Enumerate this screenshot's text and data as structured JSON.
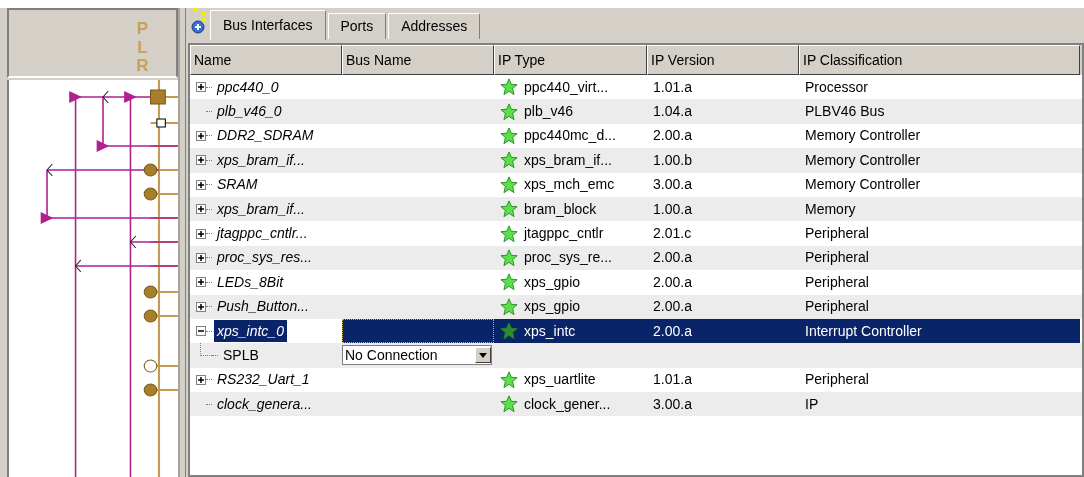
{
  "bus_panel": {
    "label": "PLR"
  },
  "tabs": [
    {
      "label": "Bus Interfaces",
      "selected": true
    },
    {
      "label": "Ports",
      "selected": false
    },
    {
      "label": "Addresses",
      "selected": false
    }
  ],
  "table": {
    "columns": [
      "Name",
      "Bus Name",
      "IP Type",
      "IP Version",
      "IP Classification"
    ],
    "rows": [
      {
        "kind": "instance",
        "has_children": true,
        "expanded": false,
        "name": "ppc440_0",
        "ip_type": "ppc440_virt...",
        "ip_version": "1.01.a",
        "ip_classification": "Processor",
        "selected": false
      },
      {
        "kind": "instance",
        "has_children": false,
        "name": "plb_v46_0",
        "ip_type": "plb_v46",
        "ip_version": "1.04.a",
        "ip_classification": "PLBV46 Bus",
        "selected": false
      },
      {
        "kind": "instance",
        "has_children": true,
        "expanded": false,
        "name": "DDR2_SDRAM",
        "ip_type": "ppc440mc_d...",
        "ip_version": "2.00.a",
        "ip_classification": "Memory Controller",
        "selected": false
      },
      {
        "kind": "instance",
        "has_children": true,
        "expanded": false,
        "name": "xps_bram_if...",
        "ip_type": "xps_bram_if...",
        "ip_version": "1.00.b",
        "ip_classification": "Memory Controller",
        "selected": false
      },
      {
        "kind": "instance",
        "has_children": true,
        "expanded": false,
        "name": "SRAM",
        "ip_type": "xps_mch_emc",
        "ip_version": "3.00.a",
        "ip_classification": "Memory Controller",
        "selected": false
      },
      {
        "kind": "instance",
        "has_children": true,
        "expanded": false,
        "name": "xps_bram_if...",
        "ip_type": "bram_block",
        "ip_version": "1.00.a",
        "ip_classification": "Memory",
        "selected": false
      },
      {
        "kind": "instance",
        "has_children": true,
        "expanded": false,
        "name": "jtagppc_cntlr...",
        "ip_type": "jtagppc_cntlr",
        "ip_version": "2.01.c",
        "ip_classification": "Peripheral",
        "selected": false
      },
      {
        "kind": "instance",
        "has_children": true,
        "expanded": false,
        "name": "proc_sys_res...",
        "ip_type": "proc_sys_re...",
        "ip_version": "2.00.a",
        "ip_classification": "Peripheral",
        "selected": false
      },
      {
        "kind": "instance",
        "has_children": true,
        "expanded": false,
        "name": "LEDs_8Bit",
        "ip_type": "xps_gpio",
        "ip_version": "2.00.a",
        "ip_classification": "Peripheral",
        "selected": false
      },
      {
        "kind": "instance",
        "has_children": true,
        "expanded": false,
        "name": "Push_Button...",
        "ip_type": "xps_gpio",
        "ip_version": "2.00.a",
        "ip_classification": "Peripheral",
        "selected": false
      },
      {
        "kind": "instance",
        "has_children": true,
        "expanded": true,
        "name": "xps_intc_0",
        "ip_type": "xps_intc",
        "ip_version": "2.00.a",
        "ip_classification": "Interrupt Controller",
        "selected": true,
        "children": [
          {
            "kind": "interface",
            "name": "SPLB",
            "bus_name": "No Connection",
            "selected": false
          }
        ]
      },
      {
        "kind": "instance",
        "has_children": true,
        "expanded": false,
        "name": "RS232_Uart_1",
        "ip_type": "xps_uartlite",
        "ip_version": "1.01.a",
        "ip_classification": "Peripheral",
        "selected": false
      },
      {
        "kind": "instance",
        "has_children": false,
        "name": "clock_genera...",
        "ip_type": "clock_gener...",
        "ip_version": "3.00.a",
        "ip_classification": "IP",
        "selected": false
      }
    ]
  }
}
